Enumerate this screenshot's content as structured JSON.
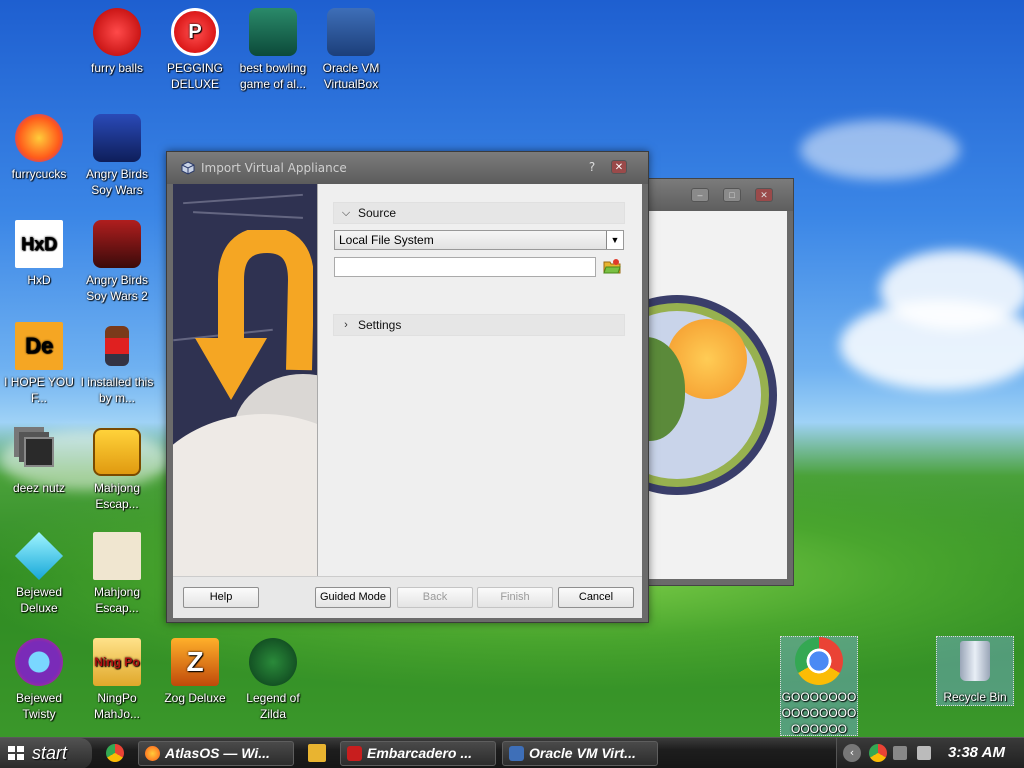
{
  "desktop_icons": [
    {
      "label": "furry balls"
    },
    {
      "label": "PEGGING DELUXE"
    },
    {
      "label": "best bowling game of al..."
    },
    {
      "label": "Oracle VM VirtualBox"
    },
    {
      "label": "furrycucks"
    },
    {
      "label": "Angry Birds Soy Wars"
    },
    {
      "label": "HxD"
    },
    {
      "label": "Angry Birds Soy Wars 2"
    },
    {
      "label": "I HOPE YOU F..."
    },
    {
      "label": "I installed this by m..."
    },
    {
      "label": "deez nutz"
    },
    {
      "label": "Mahjong Escap..."
    },
    {
      "label": "Bejewed Deluxe"
    },
    {
      "label": "Mahjong Escap..."
    },
    {
      "label": "Bejewed Twisty"
    },
    {
      "label": "NingPo MahJo..."
    },
    {
      "label": "Zog Deluxe"
    },
    {
      "label": "Legend of Zilda"
    },
    {
      "label": "GOOOOOOOOOOOOOOOOOOOOO"
    },
    {
      "label": "Recycle Bin"
    }
  ],
  "icon_glyphs": {
    "hxd": "HxD",
    "de": "De",
    "ningpo": "Ning Po"
  },
  "dialog": {
    "title": "Import Virtual Appliance",
    "help_glyph": "?",
    "close_glyph": "✕",
    "source_header": "Source",
    "source_value": "Local File System",
    "file_path": "",
    "settings_header": "Settings",
    "buttons": {
      "help": "Help",
      "guided": "Guided Mode",
      "back": "Back",
      "finish": "Finish",
      "cancel": "Cancel"
    }
  },
  "taskbar": {
    "start_label": "start",
    "items": [
      {
        "label": "AtlasOS — Wi..."
      },
      {
        "label": "Embarcadero ..."
      },
      {
        "label": "Oracle VM Virt..."
      }
    ],
    "clock": "3:38 AM"
  },
  "colors": {
    "accent": "#f5a623",
    "dialog_frame": "#6b6b6b",
    "sidebar_bg": "#2f3251"
  }
}
